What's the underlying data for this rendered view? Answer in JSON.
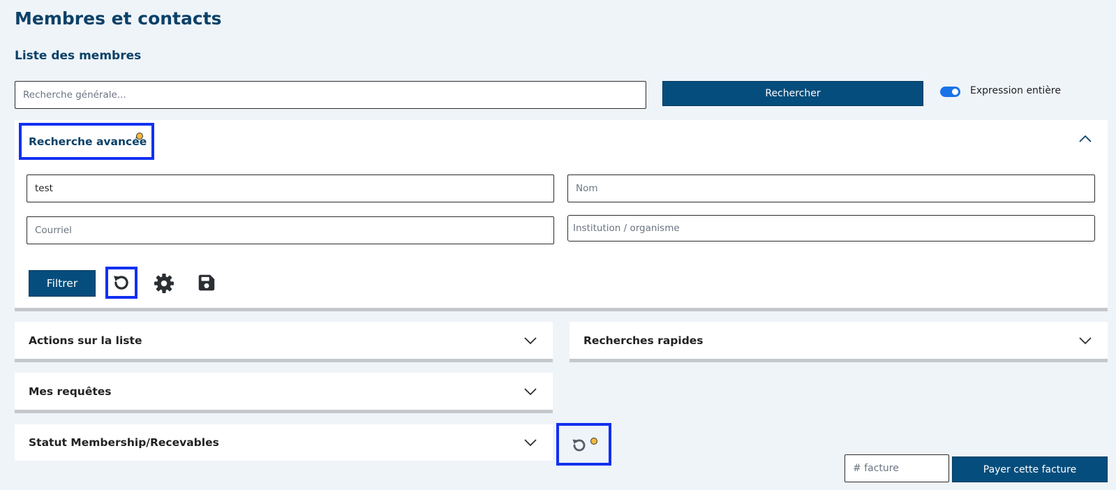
{
  "page": {
    "title": "Membres et contacts",
    "section_title": "Liste des membres"
  },
  "search": {
    "placeholder": "Recherche générale...",
    "value": "",
    "button_label": "Rechercher",
    "toggle_label": "Expression entière",
    "toggle_on": true
  },
  "advanced": {
    "title": "Recherche avancée",
    "expanded": true,
    "fields": {
      "field1": {
        "value": "test",
        "placeholder": ""
      },
      "nom": {
        "value": "",
        "placeholder": "Nom"
      },
      "courriel": {
        "value": "",
        "placeholder": "Courriel"
      },
      "institution": {
        "value": "",
        "placeholder": "Institution / organisme"
      }
    },
    "filter_label": "Filtrer",
    "icons": [
      "reset-icon",
      "gear-icon",
      "save-icon"
    ]
  },
  "panels": {
    "actions": {
      "title": "Actions sur la liste"
    },
    "quick": {
      "title": "Recherches rapides"
    },
    "queries": {
      "title": "Mes requêtes"
    },
    "status": {
      "title": "Statut Membership/Recevables"
    }
  },
  "invoice": {
    "placeholder": "# facture",
    "value": "",
    "pay_label": "Payer cette facture"
  },
  "colors": {
    "primary": "#054d7c",
    "title": "#0b4168",
    "toggle": "#1a73e8",
    "highlight": "#1230f0",
    "indicator_dot": "#f3b93a"
  }
}
